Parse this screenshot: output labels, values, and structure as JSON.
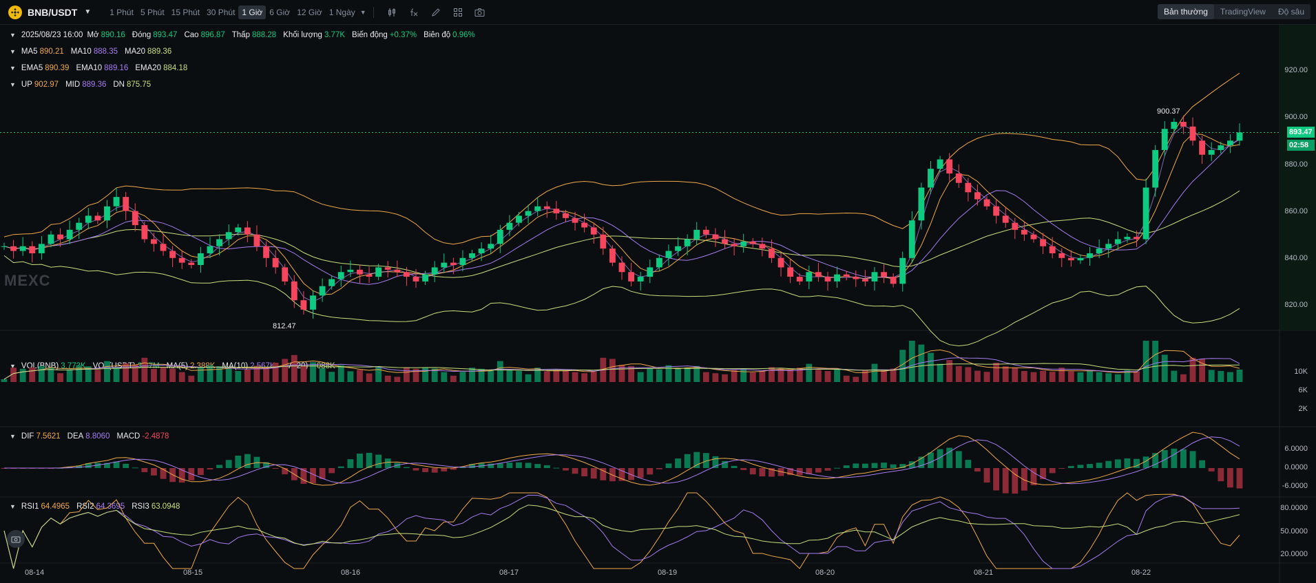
{
  "header": {
    "pair": "BNB/USDT",
    "timeframes": [
      "1 Phút",
      "5 Phút",
      "15 Phút",
      "30 Phút",
      "1 Giờ",
      "6 Giờ",
      "12 Giờ",
      "1 Ngày"
    ],
    "active_timeframe": "1 Giờ",
    "views": [
      "Bản thường",
      "TradingView",
      "Độ sâu"
    ],
    "active_view": "Bản thường",
    "tool_icons": [
      "candle-settings-icon",
      "indicator-fx-icon",
      "draw-pencil-icon",
      "layout-grid-icon",
      "camera-icon"
    ]
  },
  "ohlc": {
    "date": "2025/08/23 16:00",
    "open_label": "Mở",
    "open": "890.16",
    "close_label": "Đóng",
    "close": "893.47",
    "high_label": "Cao",
    "high": "896.87",
    "low_label": "Thấp",
    "low": "888.28",
    "volume_label": "Khối lượng",
    "volume": "3.77K",
    "change_label": "Biến động",
    "change": "+0.37%",
    "amplitude_label": "Biên độ",
    "amplitude": "0.96%"
  },
  "ma": {
    "ma5_label": "MA5",
    "ma5": "890.21",
    "ma10_label": "MA10",
    "ma10": "888.35",
    "ma20_label": "MA20",
    "ma20": "889.36"
  },
  "ema": {
    "ema5_label": "EMA5",
    "ema5": "890.39",
    "ema10_label": "EMA10",
    "ema10": "889.16",
    "ema20_label": "EMA20",
    "ema20": "884.18"
  },
  "boll": {
    "up_label": "UP",
    "up": "902.97",
    "mid_label": "MID",
    "mid": "889.36",
    "dn_label": "DN",
    "dn": "875.75"
  },
  "vol": {
    "vol_label": "VOL(BNB)",
    "vol": "3.773K",
    "volu_label": "VOL(USDT)",
    "volu": "3.37M",
    "ma5_label": "MA(5)",
    "ma5": "2.388K",
    "ma10_label": "MA(10)",
    "ma10": "2.567K",
    "ma20_label": "MA(20)",
    "ma20": "4.088K"
  },
  "macd": {
    "dif_label": "DIF",
    "dif": "7.5621",
    "dea_label": "DEA",
    "dea": "8.8060",
    "macd_label": "MACD",
    "macd": "-2.4878"
  },
  "rsi": {
    "rsi1_label": "RSI1",
    "rsi1": "64.4965",
    "rsi2_label": "RSI2",
    "rsi2": "64.3695",
    "rsi3_label": "RSI3",
    "rsi3": "63.0948"
  },
  "price_axis": [
    "920.00",
    "900.00",
    "880.00",
    "860.00",
    "840.00",
    "820.00"
  ],
  "vol_axis": [
    "10K",
    "6K",
    "2K"
  ],
  "macd_axis": [
    "6.0000",
    "0.0000",
    "-6.0000"
  ],
  "rsi_axis": [
    "80.0000",
    "50.0000",
    "20.0000"
  ],
  "date_axis": [
    "08-14",
    "08-15",
    "08-16",
    "08-17",
    "08-19",
    "08-20",
    "08-21",
    "08-22"
  ],
  "last_price": "893.47",
  "countdown": "02:58",
  "high_marker": "900.37",
  "low_marker": "812.47",
  "watermark": "MEXC",
  "colors": {
    "up": "#0ecb81",
    "down": "#f6465d",
    "ma5": "#f0a94a",
    "ma10": "#a77cf2",
    "ma20": "#c6e07a",
    "background": "#0b0e11"
  },
  "chart_data": {
    "type": "candlestick",
    "interval": "1 Giờ",
    "ylim": [
      805,
      925
    ],
    "close": [
      845,
      843,
      845,
      842,
      846,
      850,
      848,
      852,
      855,
      858,
      856,
      862,
      866,
      860,
      854,
      848,
      846,
      843,
      840,
      838,
      837,
      842,
      845,
      848,
      851,
      853,
      850,
      845,
      840,
      836,
      830,
      822,
      818,
      824,
      828,
      831,
      834,
      835,
      833,
      832,
      836,
      835,
      834,
      832,
      830,
      833,
      836,
      838,
      837,
      840,
      842,
      844,
      846,
      852,
      855,
      858,
      860,
      862,
      861,
      859,
      857,
      855,
      853,
      850,
      844,
      838,
      834,
      830,
      832,
      836,
      840,
      843,
      845,
      848,
      852,
      850,
      848,
      846,
      845,
      847,
      846,
      844,
      840,
      836,
      832,
      830,
      834,
      832,
      830,
      833,
      832,
      831,
      830,
      834,
      832,
      829,
      840,
      856,
      870,
      878,
      882,
      876,
      872,
      868,
      865,
      862,
      858,
      855,
      852,
      850,
      848,
      845,
      842,
      840,
      839,
      840,
      842,
      844,
      846,
      848,
      849,
      848,
      870,
      886,
      895,
      898,
      896,
      890,
      884,
      886,
      888,
      890,
      893.47
    ]
  }
}
